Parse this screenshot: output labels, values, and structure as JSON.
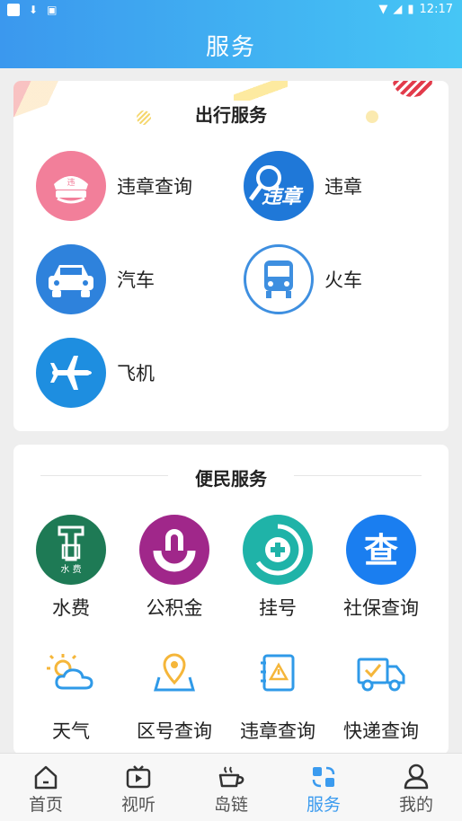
{
  "status_bar": {
    "time": "12:17"
  },
  "header": {
    "title": "服务"
  },
  "travel": {
    "title": "出行服务",
    "badge_text": "违",
    "logo_text": "违章",
    "items": [
      {
        "label": "违章查询",
        "icon": "police-cap-icon",
        "color": "#f27f9a"
      },
      {
        "label": "违章",
        "icon": "violation-search-icon",
        "color": "#1f78d8"
      },
      {
        "label": "汽车",
        "icon": "car-icon",
        "color": "#2e82dc"
      },
      {
        "label": "火车",
        "icon": "train-icon",
        "color": "#3e8fe0"
      },
      {
        "label": "飞机",
        "icon": "airplane-icon",
        "color": "#1e8ee0"
      }
    ]
  },
  "civic": {
    "title": "便民服务",
    "water_text": "水 费",
    "social_text": "查",
    "items": [
      {
        "label": "水费",
        "icon": "water-bill-icon",
        "color": "#1e7a55"
      },
      {
        "label": "公积金",
        "icon": "housing-fund-icon",
        "color": "#a0278a"
      },
      {
        "label": "挂号",
        "icon": "hospital-register-icon",
        "color": "#1fb3a8"
      },
      {
        "label": "社保查询",
        "icon": "social-security-icon",
        "color": "#1a7ef0"
      },
      {
        "label": "天气",
        "icon": "weather-icon",
        "color": "#2f9ae8"
      },
      {
        "label": "区号查询",
        "icon": "area-code-icon",
        "color": "#2f9ae8"
      },
      {
        "label": "违章查询",
        "icon": "violation-warning-icon",
        "color": "#2f9ae8"
      },
      {
        "label": "快递查询",
        "icon": "express-truck-icon",
        "color": "#2f9ae8"
      }
    ]
  },
  "tabbar": {
    "active_color": "#3b9bef",
    "tabs": [
      {
        "label": "首页",
        "icon": "home-icon"
      },
      {
        "label": "视听",
        "icon": "video-icon"
      },
      {
        "label": "岛链",
        "icon": "coffee-icon"
      },
      {
        "label": "服务",
        "icon": "services-icon",
        "active": true
      },
      {
        "label": "我的",
        "icon": "user-icon"
      }
    ]
  }
}
